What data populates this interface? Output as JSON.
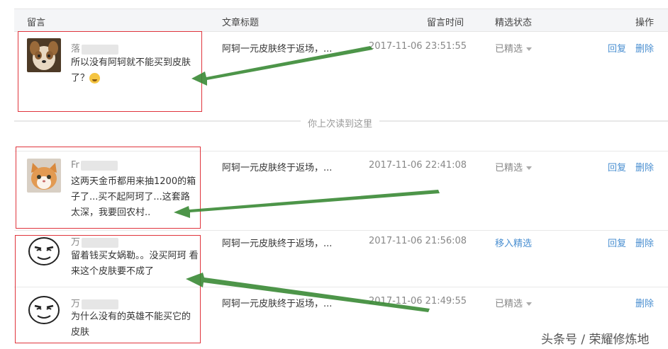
{
  "header": {
    "col_comment": "留言",
    "col_title": "文章标题",
    "col_time": "留言时间",
    "col_status": "精选状态",
    "col_action": "操作"
  },
  "rows": [
    {
      "user": "落",
      "text": "所以没有阿轲就不能买到皮肤了？",
      "emoji": "crying-face-emoji",
      "title": "阿轲一元皮肤终于返场，...",
      "time": "2017-11-06 23:51:55",
      "status": "已精选",
      "reply": "回复",
      "delete": "删除"
    },
    {
      "user": "Fr",
      "text": "这两天金币都用来抽1200的箱子了...买不起阿珂了...这套路太深，我要回农村..",
      "title": "阿轲一元皮肤终于返场，...",
      "time": "2017-11-06 22:41:08",
      "status": "已精选",
      "reply": "回复",
      "delete": "删除"
    },
    {
      "user": "万",
      "text": "留着钱买女娲勒。。没买阿珂 看来这个皮肤要不成了",
      "title": "阿轲一元皮肤终于返场，...",
      "time": "2017-11-06 21:56:08",
      "status": "移入精选",
      "reply": "回复",
      "delete": "删除"
    },
    {
      "user": "万",
      "text": "为什么没有的英雄不能买它的皮肤",
      "title": "阿轲一元皮肤终于返场，...",
      "time": "2017-11-06 21:49:55",
      "status": "已精选",
      "delete": "删除"
    }
  ],
  "divider_label": "你上次读到这里",
  "watermark": "头条号 / 荣耀修炼地",
  "colors": {
    "link": "#4a8fd1",
    "annotation_red": "#e0353d",
    "annotation_arrow": "#3a8a35"
  }
}
